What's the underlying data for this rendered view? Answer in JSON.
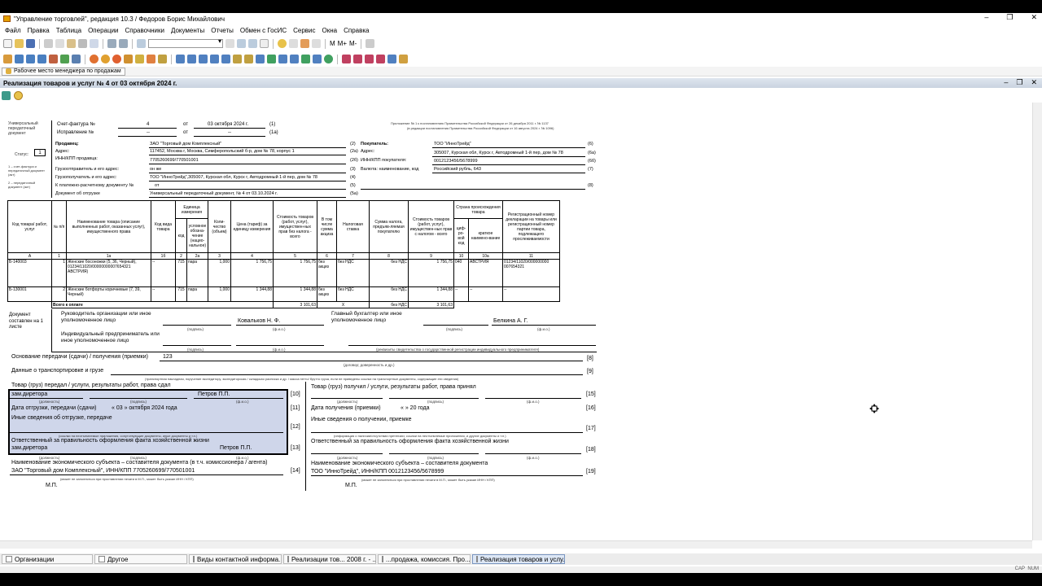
{
  "window": {
    "title": "\"Управление торговлей\", редакция 10.3 / Федоров Борис Михайлович",
    "minimize": "–",
    "restore": "❐",
    "close": "✕"
  },
  "menu": [
    "Файл",
    "Правка",
    "Таблица",
    "Операции",
    "Справочники",
    "Документы",
    "Отчеты",
    "Обмен с ГосИС",
    "Сервис",
    "Окна",
    "Справка"
  ],
  "toolbar": {
    "m_label": "M",
    "m_plus": "M+",
    "m_minus": "M-"
  },
  "subpanel": {
    "tab_label": "Рабочее место менеджера по продажам"
  },
  "document": {
    "title": "Реализация товаров и услуг № 4 от 03 октября 2024 г.",
    "upd": {
      "side_title": "Универсальный передаточный документ",
      "status_label": "Статус:",
      "status_value": "1",
      "status_note1": "1 – счет-фактура и передаточный документ (акт)",
      "status_note2": "2 – передаточный документ (акт)",
      "invoice_label": "Счет-фактура №",
      "invoice_num": "4",
      "invoice_from": "от",
      "invoice_date": "03 октября 2024 г.",
      "invoice_ref": "(1)",
      "fix_label": "Исправление №",
      "fix_num": "--",
      "fix_from": "от",
      "fix_date": "--",
      "fix_ref": "(1а)",
      "legal_note1": "Приложение № 1 к постановлению Правительства Российской Федерации от 26 декабря 2011 г. № 1137",
      "legal_note2": "(в редакции постановления Правительства Российской Федерации от 16 августа 2024 г. № 1096)",
      "seller_label": "Продавец:",
      "seller_value": "ЗАО \"Торговый дом Комплексный\"",
      "seller_ref": "(2)",
      "address_label": "Адрес:",
      "seller_address": "117452, Москва г, Москва, Симферопольский б-р, дом № 78, корпус 1",
      "seller_address_ref": "(2а)",
      "inn_label": "ИНН/КПП продавца:",
      "seller_inn": "7705260699/770501001",
      "seller_inn_ref": "(2б)",
      "shipper_label": "Грузоотправитель и его адрес:",
      "shipper_value": "он же",
      "shipper_ref": "(3)",
      "consignee_label": "Грузополучатель и его адрес:",
      "consignee_value": "ТОО \"ИнноТрейд\",305007, Курская обл, Курск г, Автодромный 1-й пер, дом № 78",
      "consignee_ref": "(4)",
      "payment_label": "К платежно-расчетному документу №",
      "payment_value": "от",
      "payment_ref": "(5)",
      "shipdoc_label": "Документ об отгрузке",
      "shipdoc_value": "Универсальный передаточный документ, № 4 от 03.10.2024 г.",
      "shipdoc_ref": "(5а)",
      "buyer_label": "Покупатель:",
      "buyer_value": "ТОО \"ИнноТрейд\"",
      "buyer_ref": "(6)",
      "buyer_address_label": "Адрес:",
      "buyer_address": "305007, Курская обл, Курск г, Автодромный 1-й пер, дом № 78",
      "buyer_address_ref": "(6а)",
      "buyer_inn_label": "ИНН/КПП покупателя:",
      "buyer_inn": "0012123456/5678999",
      "buyer_inn_ref": "(6б)",
      "currency_label": "Валюта: наименование, код",
      "currency_value": "Российский рубль, 643",
      "currency_ref": "(7)",
      "ident_ref": "(8)"
    },
    "table": {
      "headers": {
        "code": "Код товара/ работ, услуг",
        "num": "№ п/п",
        "name": "Наименование товара (описание выполненных работ, оказанных услуг), имущественного права",
        "kind_code": "Код вида товара",
        "unit": "Единица измерения",
        "unit_code": "код",
        "unit_name": "условное обозна-чение (нацио-нальное)",
        "qty": "Коли-чество (объем)",
        "price": "Цена (тариф) за единицу измерения",
        "cost_no_tax": "Стоимость товаров (работ, услуг), имуществен-ных прав без налога - всего",
        "excise": "В том числе сумма акциза",
        "tax_rate": "Налоговая ставка",
        "tax_sum": "Сумма налога, предъяв-ляемая покупателю",
        "cost_with_tax": "Стоимость товаров (работ, услуг), имуществен-ных прав с налогом - всего",
        "country": "Страна происхождения товара",
        "country_code": "циф-ро-вой код",
        "country_name": "краткое наимено-вание",
        "reg_num": "Регистрационный номер декларации на товары или регистрационный номер партии товара, подлежащего прослеживаемости"
      },
      "col_nums": [
        "А",
        "1",
        "1а",
        "1б",
        "2",
        "2а",
        "3",
        "4",
        "5",
        "6",
        "7",
        "8",
        "9",
        "10",
        "10а",
        "11"
      ],
      "rows": [
        {
          "code": "Б-140003",
          "num": "1",
          "name": "Женские босоножки (5, 36, Черный), 01234/11020/00000000007654321 АВСТРИЯ)",
          "kind_code": "--",
          "unit_code": "715",
          "unit_name": "пара",
          "qty": "1,000",
          "price": "1 756,75",
          "cost_no_tax": "1 756,75",
          "excise": "без акциз",
          "tax_rate": "без НДС",
          "tax_sum": "без НДС",
          "cost_with_tax": "1 756,75",
          "country_code": "040",
          "country_name": "АВСТРИЯ",
          "reg_num": "01234/11020/000000000 007654321"
        },
        {
          "code": "Б-130001",
          "num": "2",
          "name": "Женские ботфорты коричневые (7, 39, Черный)",
          "kind_code": "--",
          "unit_code": "715",
          "unit_name": "пара",
          "qty": "1,000",
          "price": "1 344,88",
          "cost_no_tax": "1 344,88",
          "excise": "без акциз",
          "tax_rate": "без НДС",
          "tax_sum": "без НДС",
          "cost_with_tax": "1 344,88",
          "country_code": "--",
          "country_name": "--",
          "reg_num": "--"
        }
      ],
      "total_label": "Всего к оплате",
      "total_no_tax": "3 101,63",
      "total_x": "X",
      "total_tax": "без НДС",
      "total_with_tax": "3 101,63"
    },
    "signatures": {
      "doc_composed": "Документ составлен на 1 листе",
      "head_label": "Руководитель организации или иное уполномоченное лицо",
      "head_name": "Ковальков Н. Ф.",
      "chief_acc_label": "Главный бухгалтер или иное уполномоченное лицо",
      "chief_acc_name": "Белкина А. Г.",
      "entrepreneur_label": "Индивидуальный предприниматель или иное уполномоченное лицо",
      "sig_caption": "(подпись)",
      "fio_caption": "(ф.и.о.)",
      "cert_caption": "(реквизиты свидетельства о государственной регистрации индивидуального предпринимателя)"
    },
    "transfer": {
      "basis_label": "Основание передачи (сдачи) / получения (приемки)",
      "basis_value": "123",
      "basis_ref": "[8]",
      "basis_caption": "(договор; доверенность и др.)",
      "transport_label": "Данные о транспортировке и грузе",
      "transport_ref": "[9]",
      "transport_caption": "(транспортная накладная, поручение экспедитору, экспедиторская / складская расписка и др. / масса нетто/ брутто груза, если не приведены ссылки на транспортные документы, содержащие эти сведения)",
      "left": {
        "handed_label": "Товар (груз) передал / услуги, результаты работ, права сдал",
        "position": "зам.диретора",
        "name": "Петров П.П.",
        "ref10": "[10]",
        "pos_caption": "(должность)",
        "ship_date_label": "Дата отгрузки, передачи (сдачи)",
        "ship_date": "« 03 »   октября   2024  года",
        "ref11": "[11]",
        "other_label": "Иные сведения об отгрузке, передаче",
        "ref12": "[12]",
        "other_caption": "(ссылки на неотъемлемые приложения, сопутствующие документы, иные документы и т.п.)",
        "resp_label": "Ответственный за правильность оформления факта хозяйственной жизни",
        "resp_position": "зам.диретора",
        "resp_name": "Петров П.П.",
        "ref13": "[13]",
        "entity_label": "Наименование экономического субъекта – составителя документа (в т.ч. комиссионера / агента)",
        "entity_value": "ЗАО \"Торговый дом Комплексный\", ИНН/КПП 7705260699/770501001",
        "ref14": "[14]",
        "entity_caption": "(может не заполняться при проставлении печати в М.П., может быть указан ИНН / КПП)",
        "mp": "М.П."
      },
      "right": {
        "received_label": "Товар (груз) получил / услуги, результаты работ, права принял",
        "ref15": "[15]",
        "receive_date_label": "Дата получения (приемки)",
        "receive_date": "«    »              20     года",
        "ref16": "[16]",
        "other_label": "Иные сведения о получении, приемке",
        "ref17": "[17]",
        "other_caption": "(информация о наличии/отсутствии претензии; ссылки на неотъемлемые приложения, и другие документы и т.п.)",
        "resp_label": "Ответственный за правильность оформления факта хозяйственной жизни",
        "ref18": "[18]",
        "entity_label": "Наименование экономического субъекта – составителя документа",
        "entity_value": "ТОО \"ИнноТрейд\", ИНН/КПП 0012123456/5678999",
        "ref19": "[19]",
        "entity_caption": "(может не заполняться при проставлении печати в М.П., может быть указан ИНН / КПП)",
        "mp": "М.П."
      }
    }
  },
  "taskbar": [
    {
      "label": "Организации",
      "active": false
    },
    {
      "label": "Другое",
      "active": false
    },
    {
      "label": "Виды контактной информа...",
      "active": false
    },
    {
      "label": "Реализации тов... 2008 г. - ...",
      "active": false
    },
    {
      "label": "...продажа, комиссия. Про...",
      "active": false
    },
    {
      "label": "Реализация товаров и услу...",
      "active": true
    }
  ],
  "status": {
    "cap": "CAP",
    "num": "NUM"
  },
  "colors": {
    "highlight": "#cfd6ea",
    "docbar": "#c9d3e0"
  }
}
